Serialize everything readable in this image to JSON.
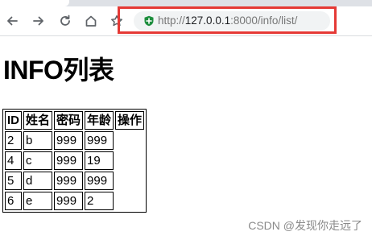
{
  "browser": {
    "url_prefix": "http://",
    "url_host": "127.0.0.1",
    "url_rest": ":8000/info/list/"
  },
  "page": {
    "heading": "INFO列表"
  },
  "table": {
    "headers": [
      "ID",
      "姓名",
      "密码",
      "年龄",
      "操作"
    ],
    "rows": [
      [
        "2",
        "b",
        "999",
        "999"
      ],
      [
        "4",
        "c",
        "999",
        "19"
      ],
      [
        "5",
        "d",
        "999",
        "999"
      ],
      [
        "6",
        "e",
        "999",
        "2"
      ]
    ]
  },
  "watermark": "CSDN @发现你走远了",
  "colors": {
    "highlight": "#e53935",
    "secure_icon": "#1e8e3e"
  }
}
